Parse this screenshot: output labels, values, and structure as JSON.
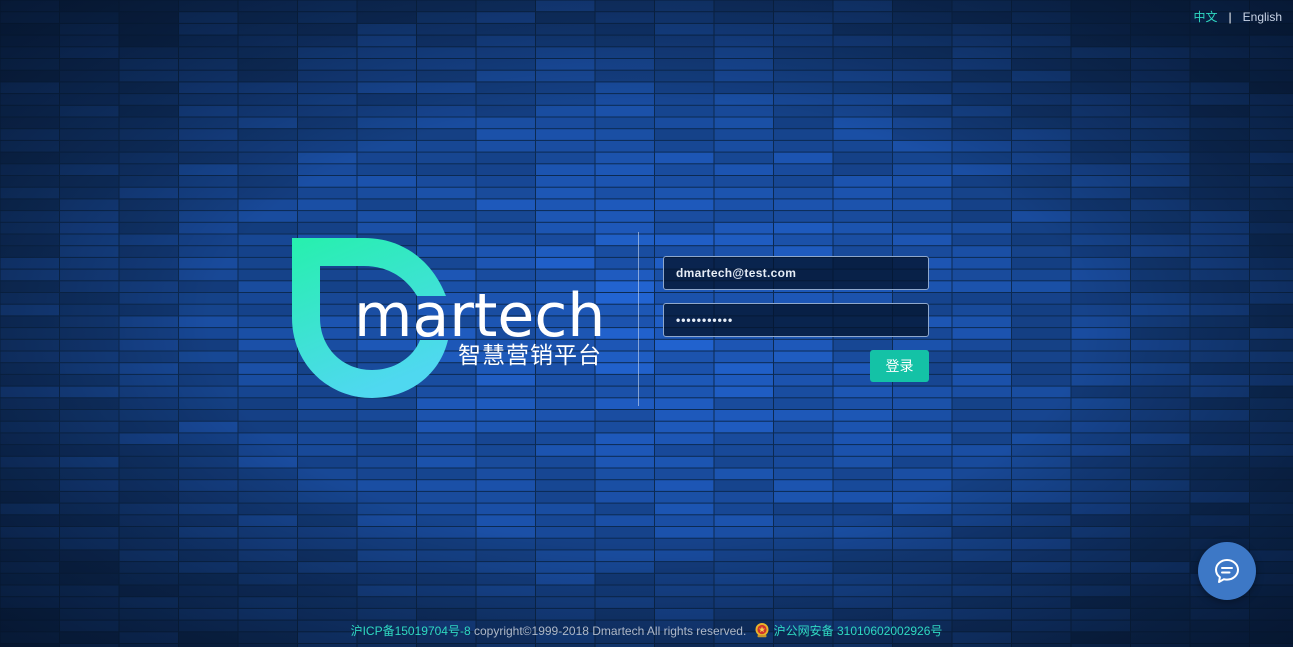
{
  "language_switch": {
    "chinese_label": "中文",
    "separator": "|",
    "english_label": "English",
    "active": "中文"
  },
  "logo": {
    "brand_name": "martech",
    "tagline": "智慧营销平台"
  },
  "login": {
    "email_value": "dmartech@test.com",
    "password_value": "•••••••••••",
    "submit_label": "登录"
  },
  "chat": {
    "icon": "chat-bubble-icon"
  },
  "footer": {
    "icp_link": "沪ICP备15019704号-8",
    "copyright": " copyright©1999-2018 Dmartech All rights reserved. ",
    "police_icon": "police-badge-icon",
    "public_security_link": "沪公网安备 31010602002926号"
  },
  "colors": {
    "accent_green": "#2fd8c1",
    "button_green": "#14c2a6",
    "chat_blue": "#3d78c6",
    "background_navy": "#0b2a55"
  }
}
